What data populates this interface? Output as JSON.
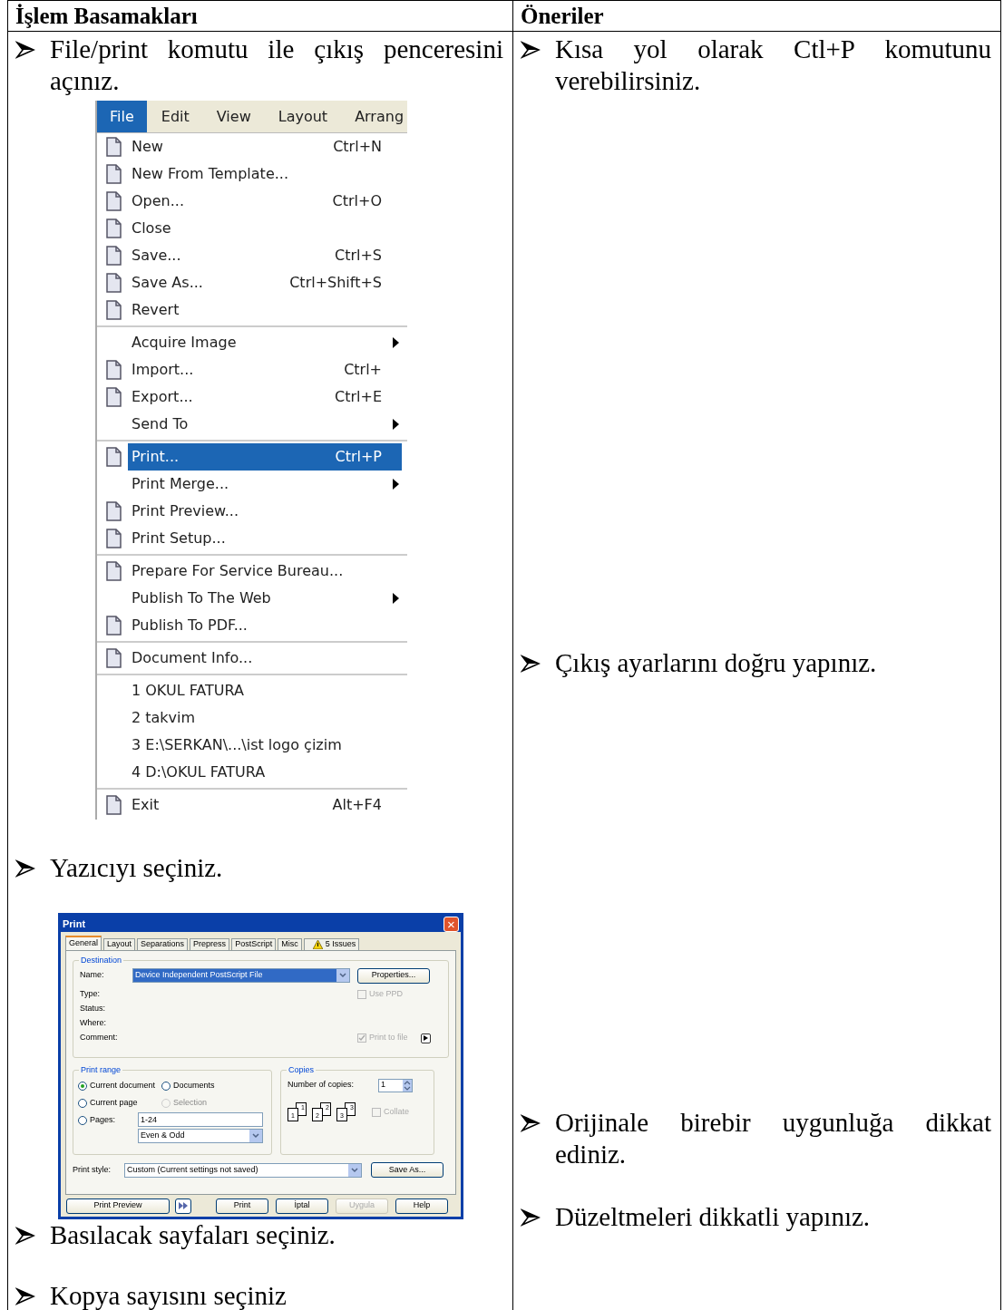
{
  "table": {
    "columns": [
      "İşlem Basamakları",
      "Öneriler"
    ],
    "steps": [
      {
        "kind": "bullet",
        "text": "File/print komutu ile çıkış penceresini açınız."
      },
      {
        "kind": "menu"
      },
      {
        "kind": "bullet",
        "text": "Yazıcıyı seçiniz."
      },
      {
        "kind": "dialog"
      },
      {
        "kind": "bullet",
        "text": "Basılacak sayfaları seçiniz."
      },
      {
        "kind": "bullet",
        "text": "Kopya sayısını seçiniz"
      }
    ],
    "tips": [
      {
        "text": "Kısa yol olarak Ctl+P komutunu verebilirsiniz."
      },
      {
        "text": "Çıkış ayarlarını doğru yapınız."
      },
      {
        "text": "Orijinale birebir uygunluğa dikkat ediniz."
      },
      {
        "text": "Düzeltmeleri dikkatli yapınız."
      }
    ]
  },
  "menu": {
    "menubar": [
      {
        "label": "File",
        "selected": true
      },
      {
        "label": "Edit",
        "selected": false
      },
      {
        "label": "View",
        "selected": false
      },
      {
        "label": "Layout",
        "selected": false
      },
      {
        "label": "Arrang",
        "selected": false
      }
    ],
    "items": [
      {
        "kind": "item",
        "label": "New",
        "shortcut": "Ctrl+N",
        "icon": true,
        "submenu": false,
        "selected": false
      },
      {
        "kind": "item",
        "label": "New From Template...",
        "icon": true,
        "submenu": false,
        "selected": false
      },
      {
        "kind": "item",
        "label": "Open...",
        "shortcut": "Ctrl+O",
        "icon": true,
        "submenu": false,
        "selected": false
      },
      {
        "kind": "item",
        "label": "Close",
        "icon": true,
        "submenu": false,
        "selected": false
      },
      {
        "kind": "item",
        "label": "Save...",
        "shortcut": "Ctrl+S",
        "icon": true,
        "submenu": false,
        "selected": false
      },
      {
        "kind": "item",
        "label": "Save As...",
        "shortcut": "Ctrl+Shift+S",
        "icon": true,
        "submenu": false,
        "selected": false
      },
      {
        "kind": "item",
        "label": "Revert",
        "icon": true,
        "submenu": false,
        "selected": false
      },
      {
        "kind": "separator"
      },
      {
        "kind": "item",
        "label": "Acquire Image",
        "icon": false,
        "submenu": true,
        "selected": false
      },
      {
        "kind": "item",
        "label": "Import...",
        "shortcut": "Ctrl+",
        "icon": true,
        "submenu": false,
        "selected": false
      },
      {
        "kind": "item",
        "label": "Export...",
        "shortcut": "Ctrl+E",
        "icon": true,
        "submenu": false,
        "selected": false
      },
      {
        "kind": "item",
        "label": "Send To",
        "icon": false,
        "submenu": true,
        "selected": false
      },
      {
        "kind": "separator"
      },
      {
        "kind": "item",
        "label": "Print...",
        "shortcut": "Ctrl+P",
        "icon": true,
        "submenu": false,
        "selected": true
      },
      {
        "kind": "item",
        "label": "Print Merge...",
        "icon": false,
        "submenu": true,
        "selected": false
      },
      {
        "kind": "item",
        "label": "Print Preview...",
        "icon": true,
        "submenu": false,
        "selected": false
      },
      {
        "kind": "item",
        "label": "Print Setup...",
        "icon": true,
        "submenu": false,
        "selected": false
      },
      {
        "kind": "separator"
      },
      {
        "kind": "item",
        "label": "Prepare For Service Bureau...",
        "icon": true,
        "submenu": false,
        "selected": false
      },
      {
        "kind": "item",
        "label": "Publish To The Web",
        "icon": false,
        "submenu": true,
        "selected": false
      },
      {
        "kind": "item",
        "label": "Publish To PDF...",
        "icon": true,
        "submenu": false,
        "selected": false
      },
      {
        "kind": "separator"
      },
      {
        "kind": "item",
        "label": "Document Info...",
        "icon": true,
        "submenu": false,
        "selected": false
      },
      {
        "kind": "separator"
      },
      {
        "kind": "item",
        "label": "1 OKUL FATURA",
        "icon": false,
        "submenu": false,
        "selected": false
      },
      {
        "kind": "item",
        "label": "2 takvim",
        "icon": false,
        "submenu": false,
        "selected": false
      },
      {
        "kind": "item",
        "label": "3 E:\\SERKAN\\...\\ist logo çizim",
        "icon": false,
        "submenu": false,
        "selected": false
      },
      {
        "kind": "item",
        "label": "4 D:\\OKUL FATURA",
        "icon": false,
        "submenu": false,
        "selected": false
      },
      {
        "kind": "separator"
      },
      {
        "kind": "item",
        "label": "Exit",
        "shortcut": "Alt+F4",
        "icon": true,
        "submenu": false,
        "selected": false
      }
    ]
  },
  "dialog": {
    "title": "Print",
    "close": "×",
    "tabs": [
      {
        "label": "General",
        "selected": true,
        "warning": false
      },
      {
        "label": "Layout",
        "selected": false,
        "warning": false
      },
      {
        "label": "Separations",
        "selected": false,
        "warning": false
      },
      {
        "label": "Prepress",
        "selected": false,
        "warning": false
      },
      {
        "label": "PostScript",
        "selected": false,
        "warning": false
      },
      {
        "label": "Misc",
        "selected": false,
        "warning": false
      },
      {
        "label": "5 Issues",
        "selected": false,
        "warning": true
      }
    ],
    "destination": {
      "legend": "Destination",
      "name_label": "Name:",
      "name_value": "Device Independent PostScript File",
      "properties": "Properties...",
      "use_ppd": {
        "label": "Use PPD",
        "checked": false,
        "disabled": true
      },
      "labels": [
        "Type:",
        "Status:",
        "Where:",
        "Comment:"
      ],
      "print_to_file": {
        "label": "Print to file",
        "checked": true,
        "disabled": true
      }
    },
    "print_range": {
      "legend": "Print range",
      "options": [
        {
          "label": "Current document",
          "selected": true,
          "disabled": false
        },
        {
          "label": "Documents",
          "selected": false,
          "disabled": false
        },
        {
          "label": "Current page",
          "selected": false,
          "disabled": false
        },
        {
          "label": "Selection",
          "selected": false,
          "disabled": true
        },
        {
          "label": "Pages:",
          "selected": false,
          "disabled": false
        }
      ],
      "pages_value": "1-24",
      "parity": "Even & Odd"
    },
    "copies": {
      "legend": "Copies",
      "count_label": "Number of copies:",
      "count": "1",
      "page_numbers": [
        "1",
        "1",
        "2",
        "2",
        "3",
        "3"
      ],
      "collate": {
        "label": "Collate",
        "checked": false,
        "disabled": true
      }
    },
    "print_style": {
      "label": "Print style:",
      "value": "Custom (Current settings not saved)",
      "save_as": "Save As..."
    },
    "buttons": [
      {
        "label": "Print Preview",
        "disabled": false,
        "kind": "text"
      },
      {
        "kind": "icon",
        "disabled": false
      },
      {
        "label": "Print",
        "disabled": false,
        "kind": "text"
      },
      {
        "label": "İptal",
        "disabled": false,
        "kind": "text"
      },
      {
        "label": "Uygula",
        "disabled": true,
        "kind": "text"
      },
      {
        "label": "Help",
        "disabled": false,
        "kind": "text"
      }
    ]
  }
}
